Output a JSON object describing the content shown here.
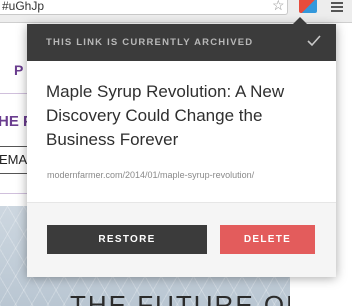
{
  "browser": {
    "url_text": "#uGhJp",
    "star_icon": "star-icon",
    "extension_icon": "archive-extension-icon",
    "menu_icon": "hamburger-menu-icon"
  },
  "background_page": {
    "tab_label": "P",
    "heading": "HE P",
    "email_text": "EMA",
    "hero_text": "THE FUTURE OF"
  },
  "popup": {
    "status_text": "THIS LINK IS CURRENTLY ARCHIVED",
    "status_icon": "check-icon",
    "article_title": "Maple Syrup Revolution: A New Discovery Could Change the Business Forever",
    "article_url": "modernfarmer.com/2014/01/maple-syrup-revolution/",
    "restore_label": "RESTORE",
    "delete_label": "DELETE",
    "colors": {
      "header_bg": "#3b3b3b",
      "restore_bg": "#3b3b3b",
      "delete_bg": "#e35c5c",
      "accent_purple": "#6a3d8f"
    }
  }
}
